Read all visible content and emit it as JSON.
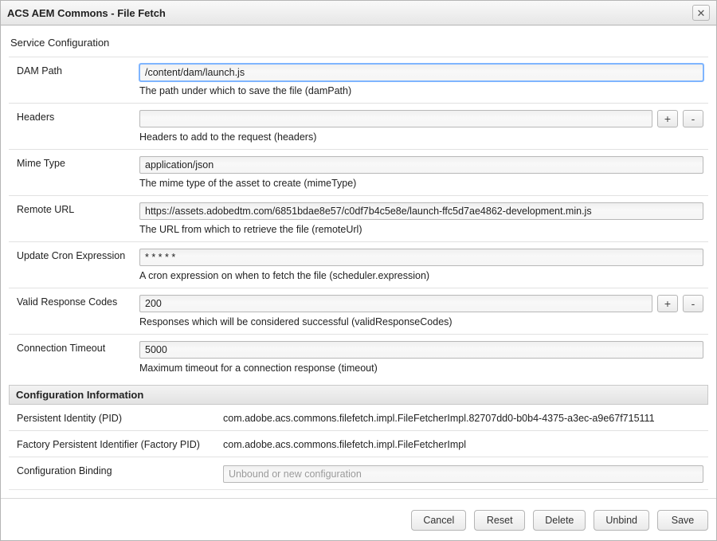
{
  "dialog": {
    "title": "ACS AEM Commons - File Fetch",
    "subtitle": "Service Configuration"
  },
  "fields": {
    "damPath": {
      "label": "DAM Path",
      "value": "/content/dam/launch.js",
      "desc": "The path under which to save the file (damPath)"
    },
    "headers": {
      "label": "Headers",
      "value": "",
      "desc": "Headers to add to the request (headers)"
    },
    "mimeType": {
      "label": "Mime Type",
      "value": "application/json",
      "desc": "The mime type of the asset to create (mimeType)"
    },
    "remoteUrl": {
      "label": "Remote URL",
      "value": "https://assets.adobedtm.com/6851bdae8e57/c0df7b4c5e8e/launch-ffc5d7ae4862-development.min.js",
      "desc": "The URL from which to retrieve the file (remoteUrl)"
    },
    "cron": {
      "label": "Update Cron Expression",
      "value": "* * * * *",
      "desc": "A cron expression on when to fetch the file (scheduler.expression)"
    },
    "validCodes": {
      "label": "Valid Response Codes",
      "value": "200",
      "desc": "Responses which will be considered successful (validResponseCodes)"
    },
    "timeout": {
      "label": "Connection Timeout",
      "value": "5000",
      "desc": "Maximum timeout for a connection response (timeout)"
    }
  },
  "configInfo": {
    "header": "Configuration Information",
    "pidLabel": "Persistent Identity (PID)",
    "pidValue": "com.adobe.acs.commons.filefetch.impl.FileFetcherImpl.82707dd0-b0b4-4375-a3ec-a9e67f715111",
    "fpidLabel": "Factory Persistent Identifier (Factory PID)",
    "fpidValue": "com.adobe.acs.commons.filefetch.impl.FileFetcherImpl",
    "bindingLabel": "Configuration Binding",
    "bindingValue": "Unbound or new configuration"
  },
  "buttons": {
    "plus": "+",
    "minus": "-",
    "close": "✕",
    "cancel": "Cancel",
    "reset": "Reset",
    "delete": "Delete",
    "unbind": "Unbind",
    "save": "Save"
  }
}
